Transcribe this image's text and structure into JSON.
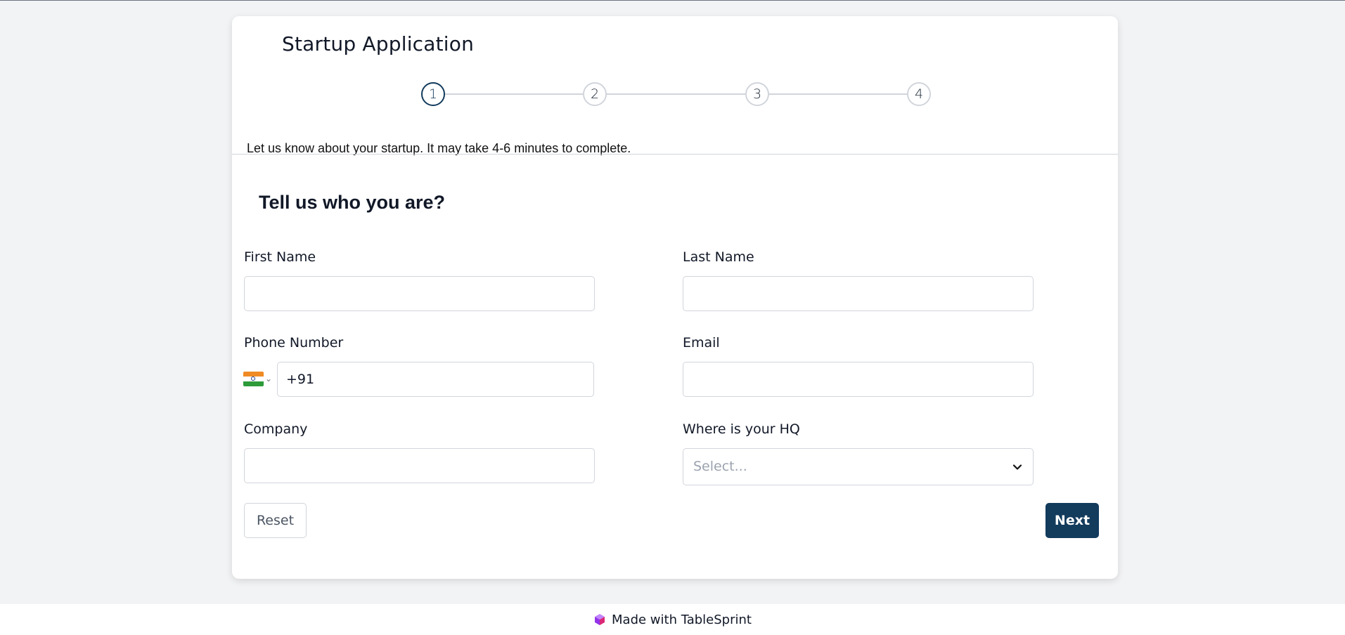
{
  "app": {
    "title": "Startup Application"
  },
  "stepper": {
    "steps": [
      "1",
      "2",
      "3",
      "4"
    ],
    "active_step": 1,
    "active_color": "#133b5c"
  },
  "intro_text": "Let us know about your startup. It may take 4-6 minutes to complete.",
  "section": {
    "title": "Tell us who you are?"
  },
  "fields": {
    "first_name": {
      "label": "First Name",
      "value": ""
    },
    "last_name": {
      "label": "Last Name",
      "value": ""
    },
    "phone": {
      "label": "Phone Number",
      "value": "+91",
      "country_flag": "india-flag-icon"
    },
    "email": {
      "label": "Email",
      "value": ""
    },
    "company": {
      "label": "Company",
      "value": ""
    },
    "hq": {
      "label": "Where is your HQ",
      "placeholder": "Select..."
    }
  },
  "buttons": {
    "reset": "Reset",
    "next": "Next"
  },
  "footer": {
    "text": "Made with TableSprint",
    "icon": "tablesprint-logo-icon"
  },
  "colors": {
    "primary": "#133b5c",
    "background": "#f2f3f5"
  }
}
